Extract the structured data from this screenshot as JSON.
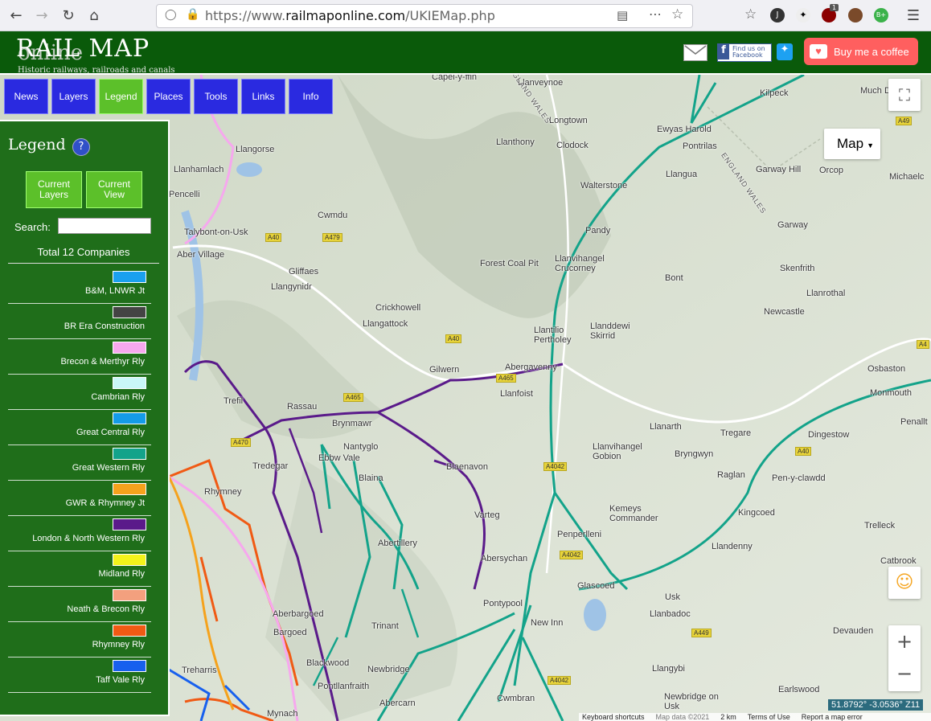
{
  "browser": {
    "url_prefix": "https://www.",
    "url_domain": "railmaponline.com",
    "url_path": "/UKIEMap.php",
    "ext_badge": "1"
  },
  "header": {
    "logo_main": "RAIL MAP",
    "logo_sub": "online",
    "tagline": "Historic railways, railroads and canals",
    "facebook_label": "Find us on Facebook",
    "coffee_label": "Buy me a coffee"
  },
  "nav": {
    "items": [
      "News",
      "Layers",
      "Legend",
      "Places",
      "Tools",
      "Links",
      "Info"
    ],
    "active": "Legend"
  },
  "legend": {
    "title": "Legend",
    "help": "?",
    "btn_current_layers": "Current Layers",
    "btn_current_view": "Current View",
    "search_label": "Search:",
    "search_value": "",
    "total": "Total 12 Companies",
    "companies": [
      {
        "name": "B&M, LNWR Jt",
        "color": "#1aa0ee"
      },
      {
        "name": "BR Era Construction",
        "color": "#444444"
      },
      {
        "name": "Brecon & Merthyr Rly",
        "color": "#f6a8ee"
      },
      {
        "name": "Cambrian Rly",
        "color": "#c9f7f7"
      },
      {
        "name": "Great Central Rly",
        "color": "#149be8"
      },
      {
        "name": "Great Western Rly",
        "color": "#13a38a"
      },
      {
        "name": "GWR & Rhymney Jt",
        "color": "#f5a21c"
      },
      {
        "name": "London & North Western Rly",
        "color": "#5a1a8a"
      },
      {
        "name": "Midland Rly",
        "color": "#f3f31a"
      },
      {
        "name": "Neath & Brecon Rly",
        "color": "#f3a07e"
      },
      {
        "name": "Rhymney Rly",
        "color": "#f05a14"
      },
      {
        "name": "Taff Vale Rly",
        "color": "#1760ee"
      }
    ]
  },
  "map": {
    "type_label": "Map",
    "coords": "51.8792° -3.0536° Z11",
    "footer": [
      "Keyboard shortcuts",
      "Map data ©2021",
      "2 km",
      "Terms of Use",
      "Report a map error"
    ],
    "places": [
      "Capel-y-ffin",
      "Llanveynoe",
      "Kilpeck",
      "Much D",
      "Longtown",
      "Ewyas Harold",
      "Llanthony",
      "Clodock",
      "Pontrilas",
      "Llangorse",
      "Llangua",
      "Garway Hill",
      "Orcop",
      "Michaelc",
      "Walterstone",
      "Llanhamlach",
      "Pencelli",
      "Cwmdu",
      "Garway",
      "Talybont-on-Usk",
      "Pandy",
      "Skenfrith",
      "Aber Village",
      "Gliffaes",
      "Forest Coal Pit",
      "Llanvihangel Crucorney",
      "Llangynidr",
      "Bont",
      "Llanrothal",
      "Crickhowell",
      "Newcastle",
      "Llangattock",
      "Llanddewi Skirrid",
      "Llantilio Pertholey",
      "Gilwern",
      "Abergavenny",
      "Osbaston",
      "Llanfoist",
      "Monmouth",
      "Trefil",
      "Rassau",
      "Brynmawr",
      "Llanarth",
      "Tregare",
      "Dingestow",
      "Penallt",
      "Nantyglo",
      "Llanvihangel Gobion",
      "Bryngwyn",
      "Tredegar",
      "Ebbw Vale",
      "Blaenavon",
      "Raglan",
      "Pen-y-clawdd",
      "Blaina",
      "Kemeys Commander",
      "Kingcoed",
      "Varteg",
      "Penperlleni",
      "Trelleck",
      "Rhymney",
      "Llandenny",
      "Abertillery",
      "Abersychan",
      "Catbrook",
      "Glascoed",
      "Usk",
      "Aberbargoed",
      "Pontypool",
      "New Inn",
      "Llanbadoc",
      "Devauden",
      "Bargoed",
      "Trinant",
      "Blackwood",
      "Newbridge",
      "Llangybi",
      "Treharris",
      "Pontllanfraith",
      "Earlswood",
      "Cwmbran",
      "Newbridge on Usk",
      "Abercarn",
      "Mynach"
    ],
    "roads": [
      "A40",
      "A479",
      "A465",
      "A40",
      "A465",
      "A4042",
      "A4042",
      "A4042",
      "A449",
      "A40",
      "A49",
      "A470",
      "A4"
    ],
    "boundary": [
      "ENGLAND WALES",
      "ENGLAND WALES"
    ]
  }
}
